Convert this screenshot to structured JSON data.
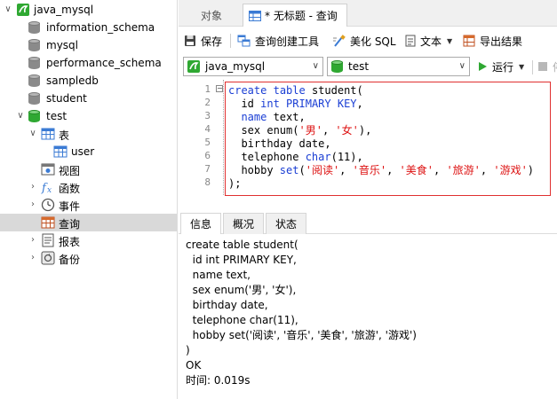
{
  "sidebar": {
    "connection": "java_mysql",
    "databases": [
      "information_schema",
      "mysql",
      "performance_schema",
      "sampledb",
      "student",
      "test"
    ],
    "test_children": {
      "tables": "表",
      "table_user": "user",
      "views": "视图",
      "functions": "函数",
      "events": "事件",
      "queries": "查询",
      "reports": "报表",
      "backups": "备份"
    }
  },
  "tabs": {
    "objects": "对象",
    "query_tab": "* 无标题 - 查询"
  },
  "toolbar": {
    "save": "保存",
    "query_builder": "查询创建工具",
    "beautify": "美化 SQL",
    "text": "文本",
    "export": "导出结果",
    "run": "运行"
  },
  "selects": {
    "connection": "java_mysql",
    "database": "test"
  },
  "editor": {
    "line_numbers": [
      "1",
      "2",
      "3",
      "4",
      "5",
      "6",
      "7",
      "8"
    ]
  },
  "bottom_tabs": {
    "info": "信息",
    "overview": "概况",
    "status": "状态"
  },
  "output": {
    "lines": [
      "create table student(",
      "  id int PRIMARY KEY,",
      "  name text,",
      "  sex enum('男', '女'),",
      "  birthday date,",
      "  telephone char(11),",
      "  hobby set('阅读', '音乐', '美食', '旅游', '游戏')",
      ")",
      "OK",
      "时间: 0.019s"
    ]
  },
  "colors": {
    "selected_row": "#d9d9d9",
    "keyword": "#1a3ed4",
    "string": "#dd1111",
    "highlight_border": "#e03030",
    "run_green": "#2fa832"
  }
}
